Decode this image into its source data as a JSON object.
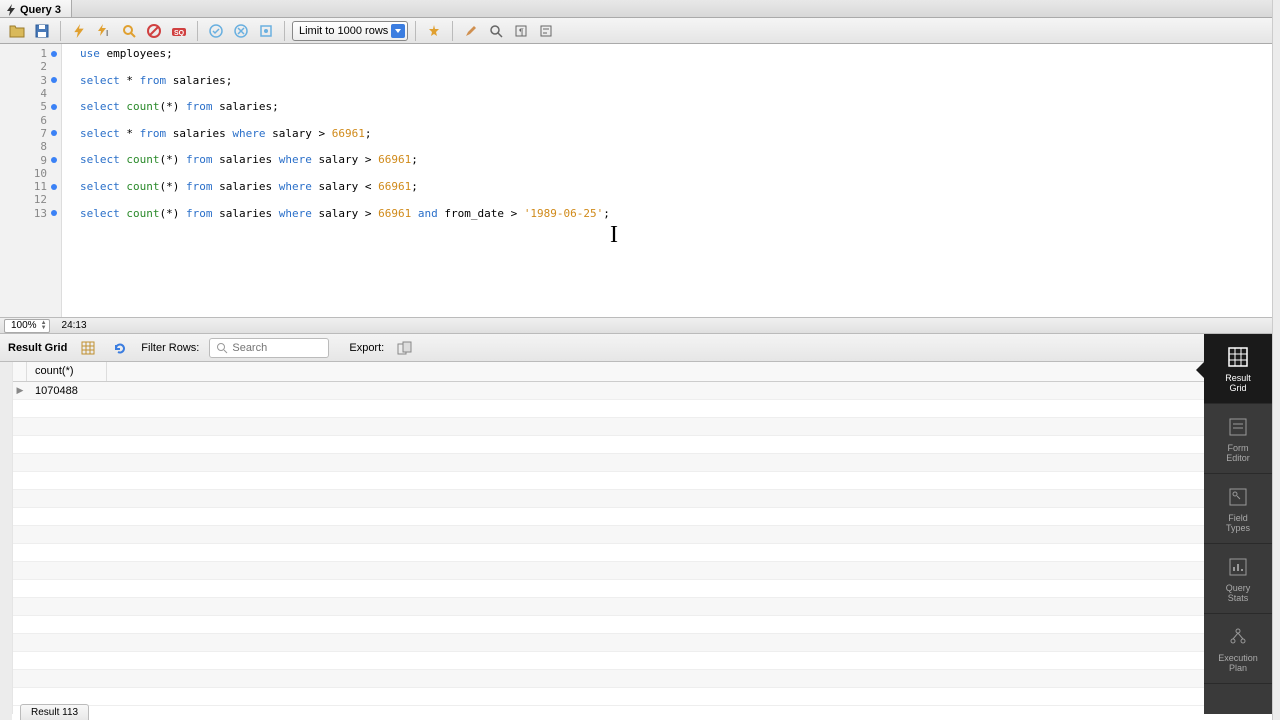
{
  "tab": {
    "title": "Query 3"
  },
  "toolbar": {
    "limit_label": "Limit to 1000 rows"
  },
  "editor": {
    "lines": [
      {
        "n": 1,
        "mark": true
      },
      {
        "n": 2,
        "mark": false
      },
      {
        "n": 3,
        "mark": true
      },
      {
        "n": 4,
        "mark": false
      },
      {
        "n": 5,
        "mark": true
      },
      {
        "n": 6,
        "mark": false
      },
      {
        "n": 7,
        "mark": true
      },
      {
        "n": 8,
        "mark": false
      },
      {
        "n": 9,
        "mark": true
      },
      {
        "n": 10,
        "mark": false
      },
      {
        "n": 11,
        "mark": true
      },
      {
        "n": 12,
        "mark": false
      },
      {
        "n": 13,
        "mark": true
      }
    ],
    "code": {
      "l1_kw": "use",
      "l1_rest": " employees;",
      "l3_sel": "select",
      "l3_star": " * ",
      "l3_from": "from",
      "l3_rest": " salaries;",
      "l5_sel": "select",
      "l5_count": " count",
      "l5_p": "(*) ",
      "l5_from": "from",
      "l5_rest": " salaries;",
      "l7_sel": "select",
      "l7_star": " * ",
      "l7_from": "from",
      "l7_t": " salaries ",
      "l7_where": "where",
      "l7_c": " salary > ",
      "l7_n": "66961",
      "l7_end": ";",
      "l9_sel": "select",
      "l9_count": " count",
      "l9_p": "(*) ",
      "l9_from": "from",
      "l9_t": " salaries ",
      "l9_where": "where",
      "l9_c": " salary > ",
      "l9_n": "66961",
      "l9_end": ";",
      "l11_sel": "select",
      "l11_count": " count",
      "l11_p": "(*) ",
      "l11_from": "from",
      "l11_t": " salaries ",
      "l11_where": "where",
      "l11_c": " salary < ",
      "l11_n": "66961",
      "l11_end": ";",
      "l13_sel": "select",
      "l13_count": " count",
      "l13_p": "(*) ",
      "l13_from": "from",
      "l13_t": " salaries ",
      "l13_where": "where",
      "l13_c": " salary > ",
      "l13_n": "66961",
      "l13_sp": " ",
      "l13_and": "and",
      "l13_c2": " from_date > ",
      "l13_str": "'1989-06-25'",
      "l13_end": ";"
    }
  },
  "status": {
    "zoom": "100%",
    "pos": "24:13"
  },
  "result_toolbar": {
    "grid_label": "Result Grid",
    "filter_label": "Filter Rows:",
    "search_placeholder": "Search",
    "export_label": "Export:"
  },
  "grid": {
    "columns": [
      "count(*)"
    ],
    "rows": [
      [
        "1070488"
      ]
    ]
  },
  "side": {
    "result_grid": "Result\nGrid",
    "form_editor": "Form\nEditor",
    "field_types": "Field\nTypes",
    "query_stats": "Query\nStats",
    "exec_plan": "Execution\nPlan"
  },
  "bottom_tab": "Result 113"
}
